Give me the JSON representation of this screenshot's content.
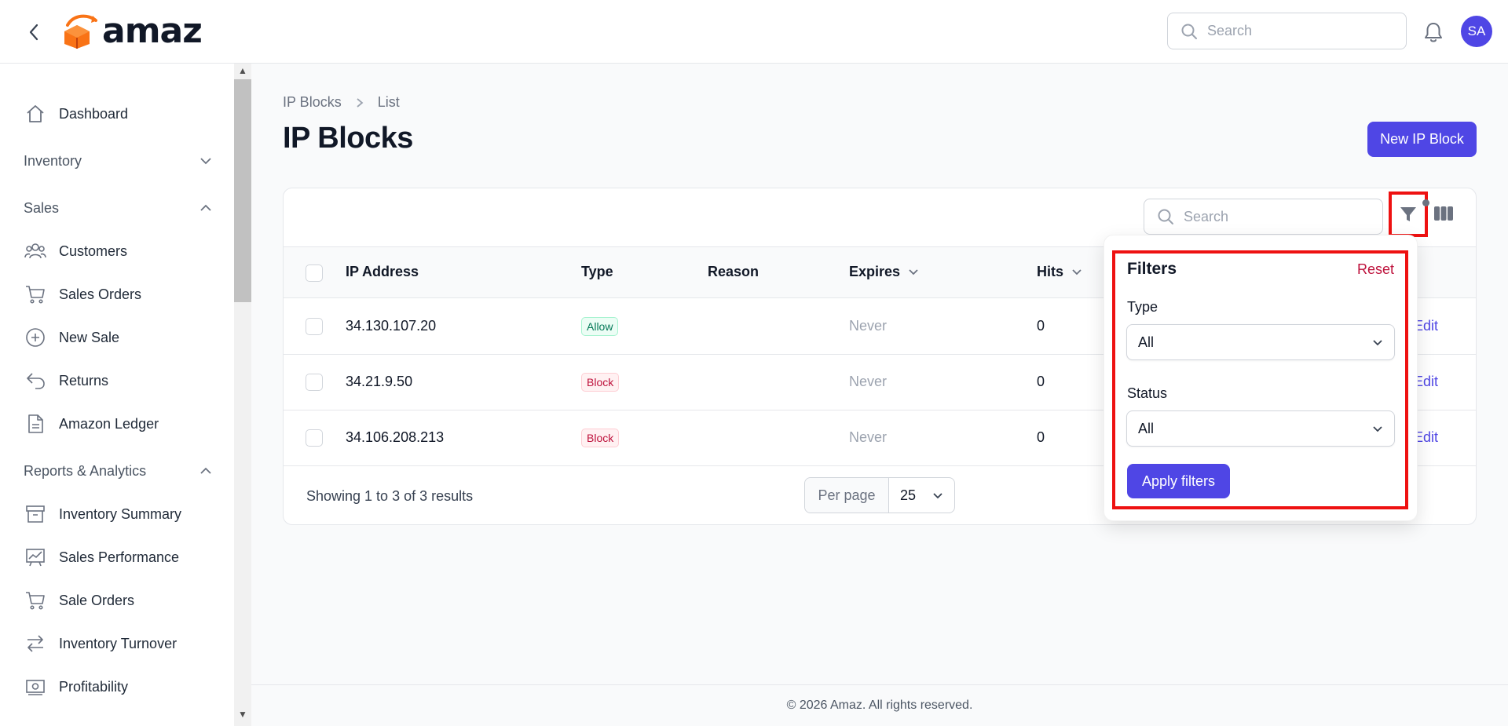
{
  "app": {
    "name": "amaz",
    "avatar_initials": "SA"
  },
  "header": {
    "search_placeholder": "Search"
  },
  "sidebar": {
    "items": [
      {
        "label": "Dashboard",
        "icon": "home-icon"
      },
      {
        "label": "Inventory",
        "group": true,
        "expanded": false
      },
      {
        "label": "Sales",
        "group": true,
        "expanded": true
      },
      {
        "label": "Customers",
        "icon": "users-icon"
      },
      {
        "label": "Sales Orders",
        "icon": "cart-icon"
      },
      {
        "label": "New Sale",
        "icon": "plus-circle-icon"
      },
      {
        "label": "Returns",
        "icon": "return-icon"
      },
      {
        "label": "Amazon Ledger",
        "icon": "document-icon"
      },
      {
        "label": "Reports & Analytics",
        "group": true,
        "expanded": true
      },
      {
        "label": "Inventory Summary",
        "icon": "archive-icon"
      },
      {
        "label": "Sales Performance",
        "icon": "chart-icon"
      },
      {
        "label": "Sale Orders",
        "icon": "cart-icon"
      },
      {
        "label": "Inventory Turnover",
        "icon": "arrows-icon"
      },
      {
        "label": "Profitability",
        "icon": "cash-icon"
      }
    ]
  },
  "breadcrumb": {
    "parent": "IP Blocks",
    "current": "List"
  },
  "page": {
    "title": "IP Blocks",
    "new_button": "New IP Block"
  },
  "table": {
    "search_placeholder": "Search",
    "columns": {
      "ip": "IP Address",
      "type": "Type",
      "reason": "Reason",
      "expires": "Expires",
      "hits": "Hits"
    },
    "rows": [
      {
        "ip": "34.130.107.20",
        "type": "Allow",
        "reason": "",
        "expires": "Never",
        "hits": "0",
        "action": "Edit"
      },
      {
        "ip": "34.21.9.50",
        "type": "Block",
        "reason": "",
        "expires": "Never",
        "hits": "0",
        "action": "Edit"
      },
      {
        "ip": "34.106.208.213",
        "type": "Block",
        "reason": "",
        "expires": "Never",
        "hits": "0",
        "action": "Edit"
      }
    ],
    "showing": "Showing 1 to 3 of 3 results",
    "per_page_label": "Per page",
    "per_page_value": "25"
  },
  "filters": {
    "title": "Filters",
    "reset": "Reset",
    "type_label": "Type",
    "type_value": "All",
    "status_label": "Status",
    "status_value": "All",
    "apply": "Apply filters"
  },
  "footer": {
    "text": "© 2026 Amaz. All rights reserved."
  },
  "colors": {
    "primary": "#4f46e5",
    "danger": "#be123c",
    "allow": "#047857",
    "highlight": "#ee1111"
  }
}
